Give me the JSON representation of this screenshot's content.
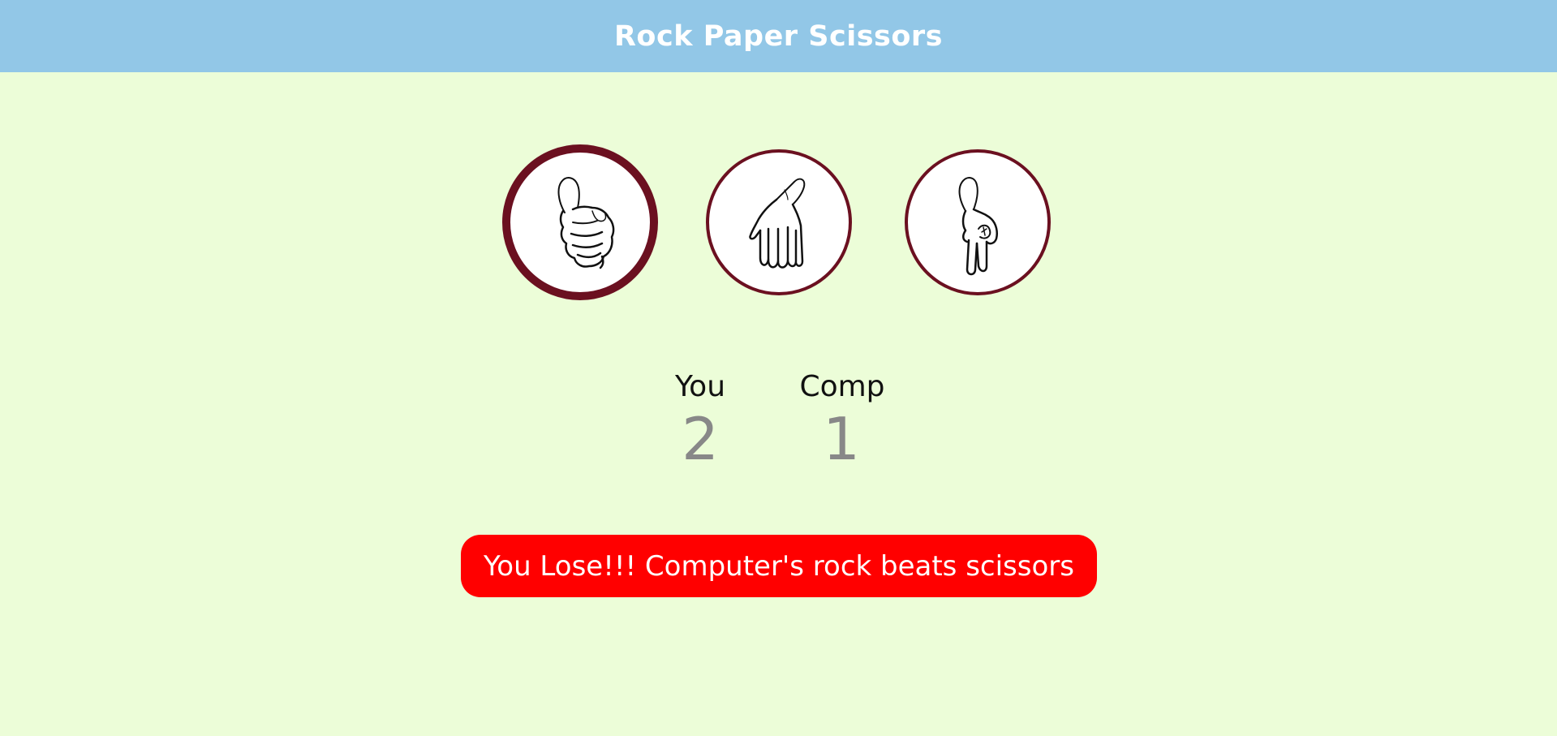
{
  "app": {
    "title": "Rock Paper Scissors",
    "header_color": "#92c7e7",
    "background_color": "#ecfdd8"
  },
  "choices": [
    {
      "id": "rock",
      "icon": "rock-hand-icon",
      "selected": true
    },
    {
      "id": "paper",
      "icon": "paper-hand-icon",
      "selected": false
    },
    {
      "id": "scissors",
      "icon": "scissors-hand-icon",
      "selected": false
    }
  ],
  "choice_border_color": "#6b1020",
  "score": {
    "user_label": "You",
    "user_value": "2",
    "comp_label": "Comp",
    "comp_value": "1"
  },
  "result": {
    "message": "You Lose!!! Computer's rock beats scissors",
    "status": "lose",
    "color": "#ff0000"
  }
}
